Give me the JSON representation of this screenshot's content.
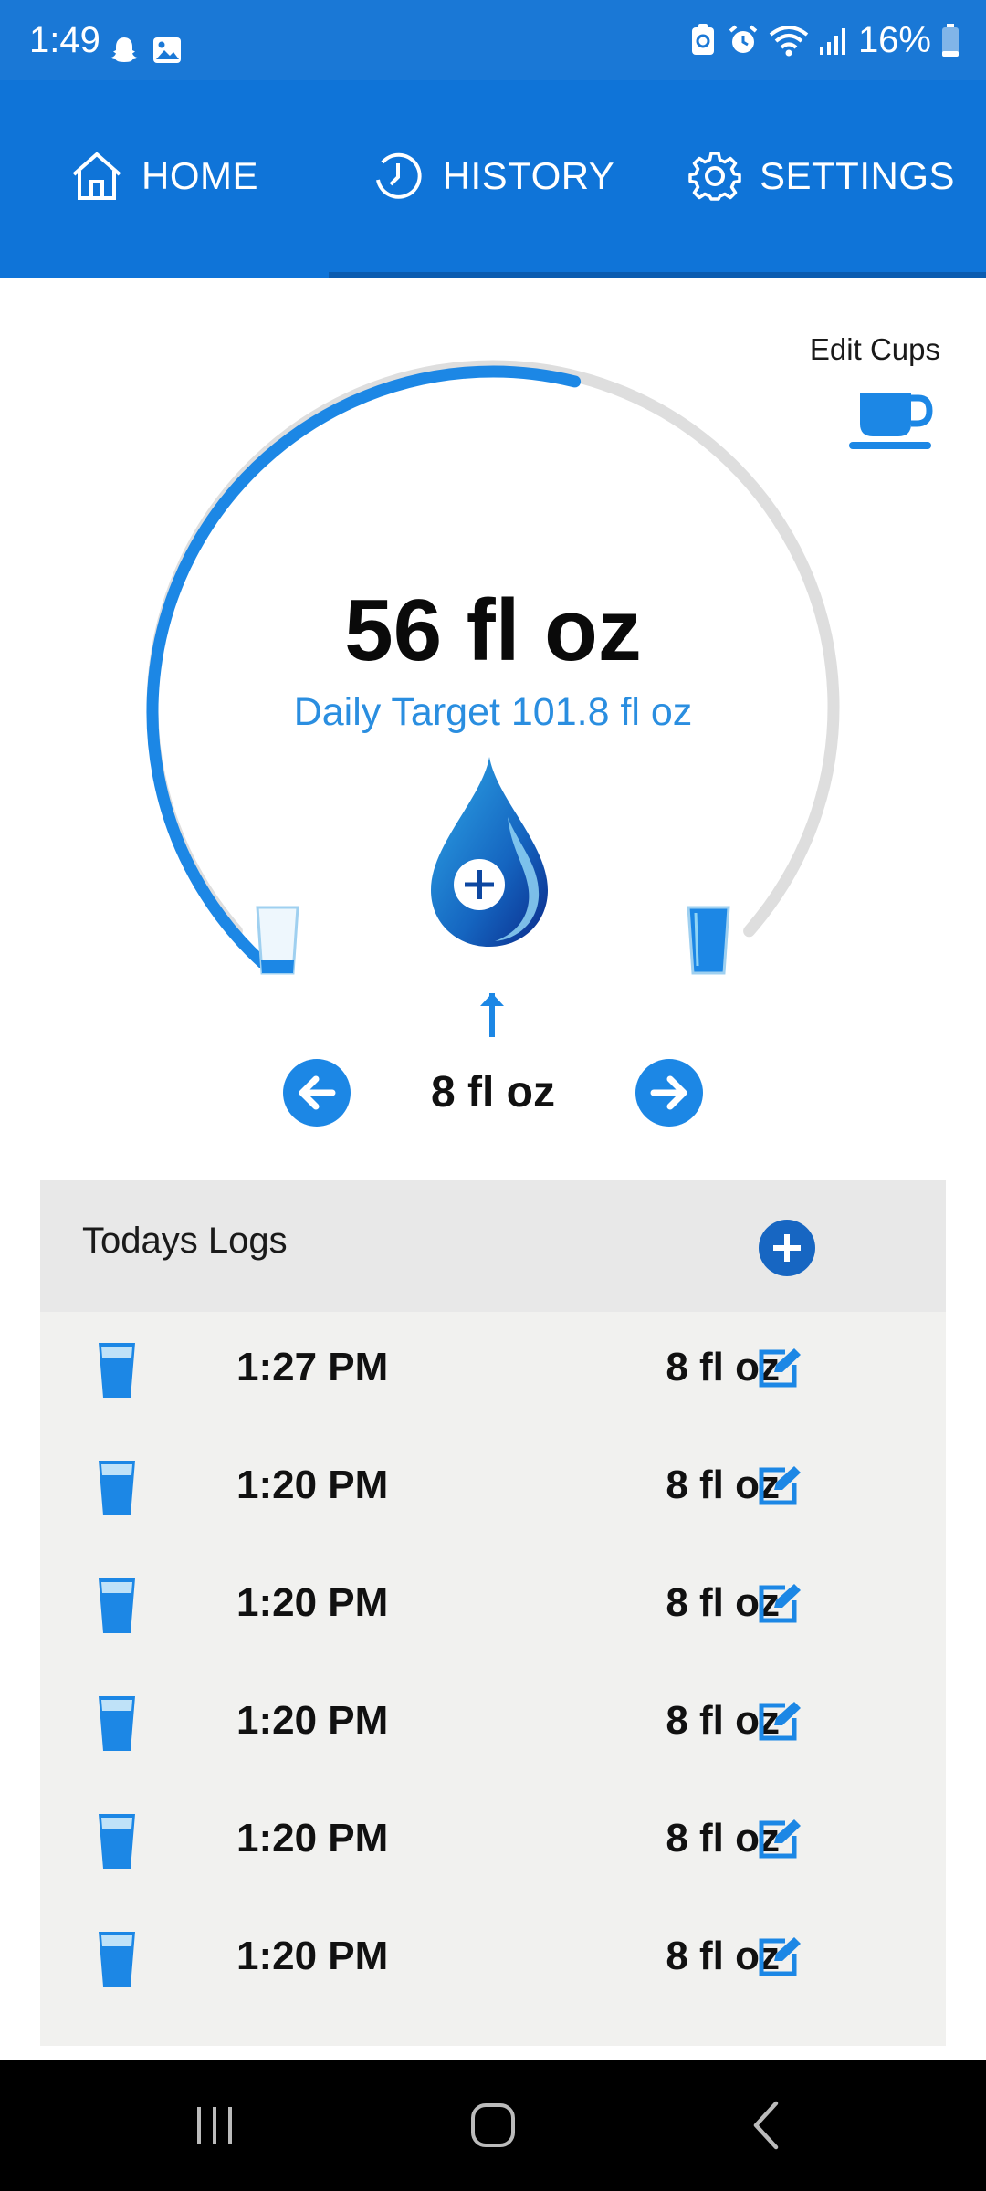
{
  "status_bar": {
    "time": "1:49",
    "battery": "16%"
  },
  "tabs": [
    {
      "label": "HOME",
      "icon": "home-icon",
      "active": true
    },
    {
      "label": "HISTORY",
      "icon": "history-icon",
      "active": false
    },
    {
      "label": "SETTINGS",
      "icon": "gear-icon",
      "active": false
    }
  ],
  "edit_cups": {
    "label": "Edit Cups",
    "icon": "cup-icon"
  },
  "intake": {
    "value": "56 fl oz",
    "target": "Daily Target 101.8 fl oz",
    "progress": 0.55
  },
  "cup_size": "8 fl oz",
  "logs": {
    "title": "Todays Logs",
    "entries": [
      {
        "time": "1:27 PM",
        "amount": "8 fl oz"
      },
      {
        "time": "1:20 PM",
        "amount": "8 fl oz"
      },
      {
        "time": "1:20 PM",
        "amount": "8 fl oz"
      },
      {
        "time": "1:20 PM",
        "amount": "8 fl oz"
      },
      {
        "time": "1:20 PM",
        "amount": "8 fl oz"
      },
      {
        "time": "1:20 PM",
        "amount": "8 fl oz"
      }
    ]
  },
  "colors": {
    "primary": "#0f74d8",
    "status_bar": "#1a78d6",
    "accent": "#2a8ee0",
    "track": "#dedede",
    "logs_bg": "#f1f1ef"
  }
}
